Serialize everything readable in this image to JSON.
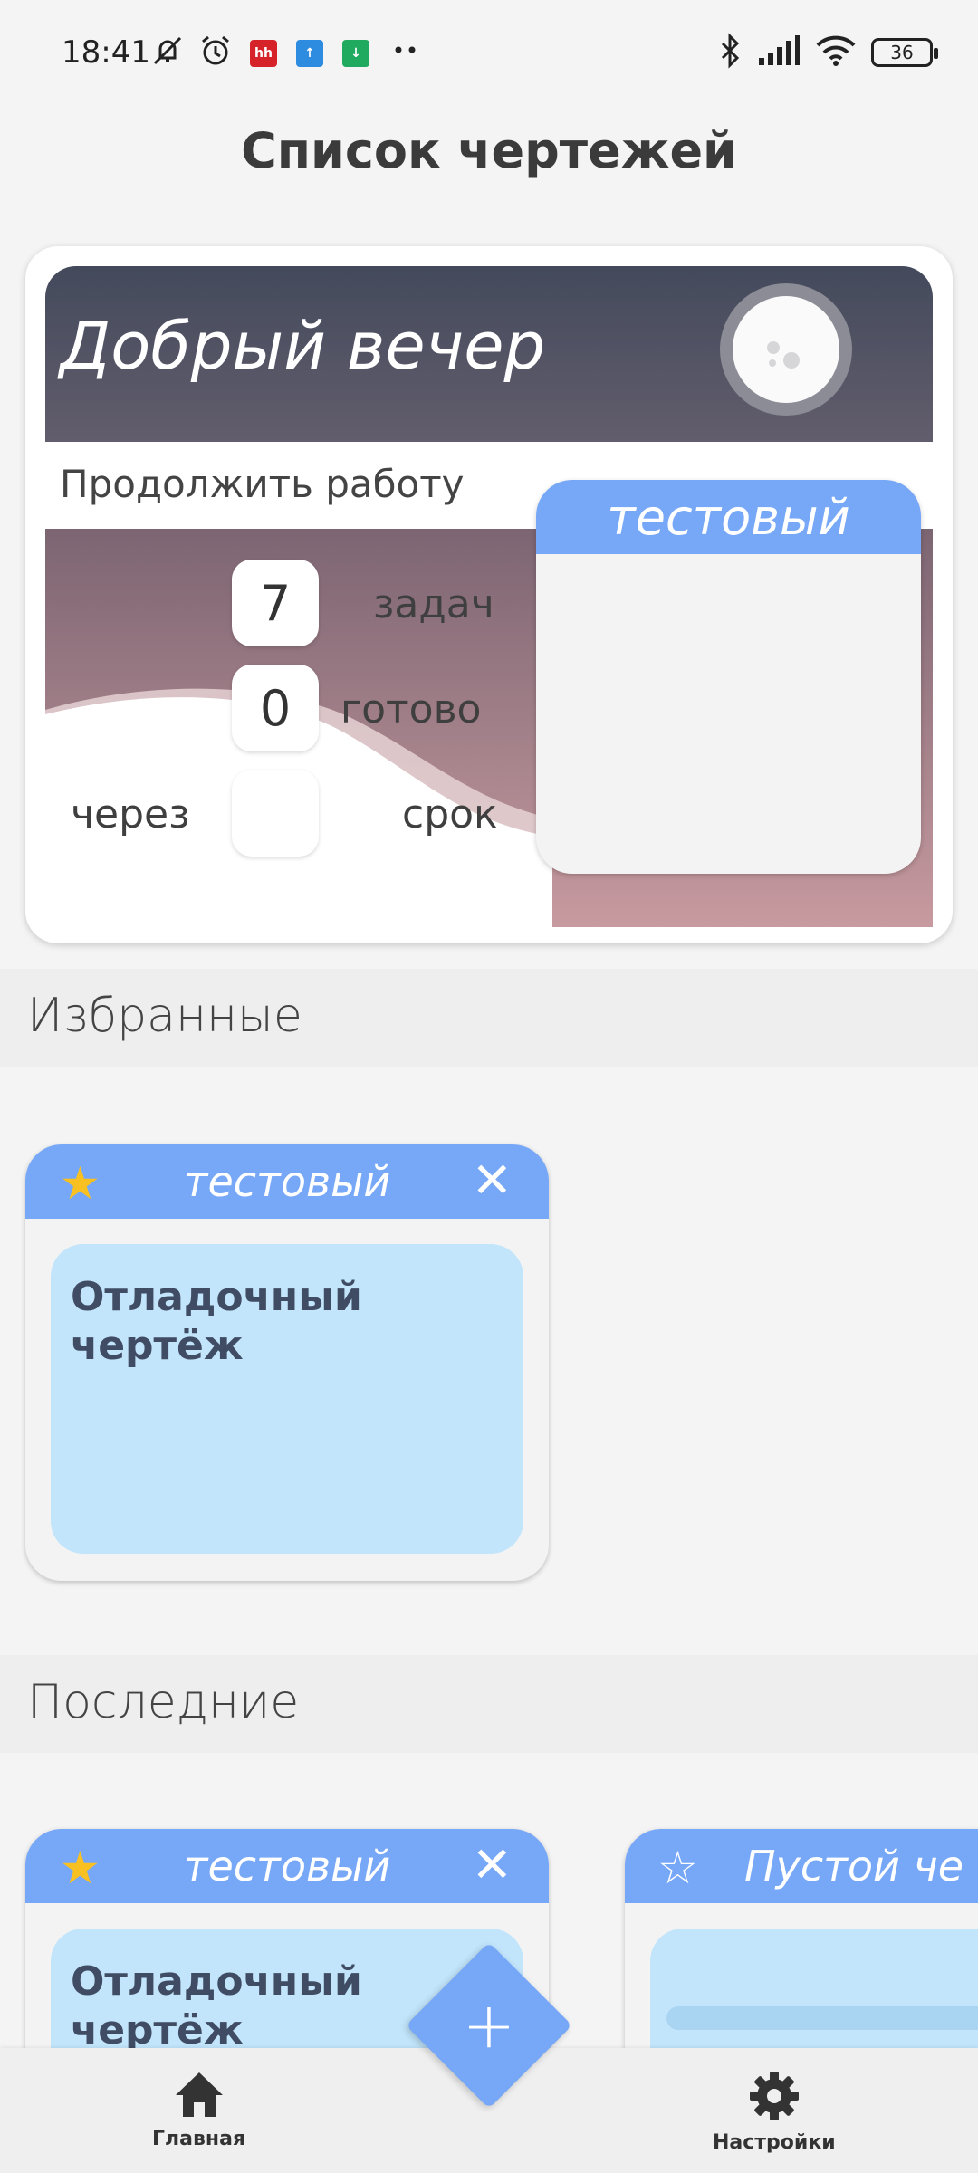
{
  "status_bar": {
    "time": "18:41",
    "battery": "36",
    "app_badges": [
      "hh",
      "↑",
      "↓"
    ],
    "icons": [
      "mute-icon",
      "alarm-icon",
      "bluetooth-icon",
      "signal-icon",
      "wifi-icon"
    ]
  },
  "header": {
    "title": "Список чертежей"
  },
  "main_card": {
    "greeting": "Добрый вечер",
    "continue_label": "Продолжить работу",
    "stats": {
      "tasks_value": "7",
      "tasks_label": "задач",
      "done_value": "0",
      "done_label": "готово",
      "deadline_prefix": "через",
      "deadline_value": "",
      "deadline_label": "срок"
    },
    "project_name": "тестовый"
  },
  "favorites": {
    "heading": "Избранные",
    "cards": [
      {
        "project": "тестовый",
        "drawing": "Отладочный чертёж",
        "starred": true
      }
    ]
  },
  "recent": {
    "heading": "Последние",
    "cards": [
      {
        "project": "тестовый",
        "drawing": "Отладочный чертёж",
        "starred": true
      },
      {
        "project": "Пустой че",
        "drawing": "",
        "starred": false
      }
    ]
  },
  "bottom_nav": {
    "home_label": "Главная",
    "settings_label": "Настройки",
    "fab_icon": "+"
  },
  "colors": {
    "accent": "#77a7f7",
    "drawing_bg": "#c2e5fb",
    "banner_top": "#434a5c",
    "wave_top": "#7c6572"
  }
}
